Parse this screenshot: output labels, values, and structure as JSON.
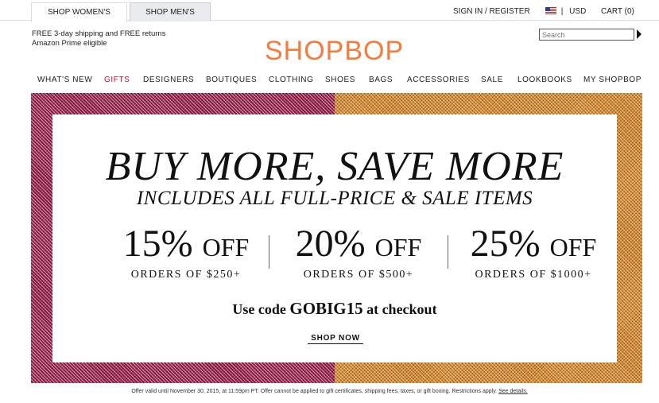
{
  "topbar": {
    "tab_women": "SHOP WOMEN'S",
    "tab_men": "SHOP MEN'S",
    "signin": "SIGN IN / REGISTER",
    "currency_sep": "|",
    "currency": "USD",
    "cart": "CART (0)"
  },
  "header": {
    "shipping_line1": "FREE 3-day shipping and FREE returns",
    "shipping_line2": "Amazon Prime eligible",
    "logo": "SHOPBOP",
    "search_placeholder": "Search"
  },
  "nav": {
    "items": [
      "WHAT'S NEW",
      "GIFTS",
      "DESIGNERS",
      "BOUTIQUES",
      "CLOTHING",
      "SHOES",
      "BAGS",
      "ACCESSORIES",
      "SALE",
      "LOOKBOOKS",
      "MY SHOPBOP"
    ],
    "highlight_color": "#c8102e"
  },
  "banner": {
    "headline": "BUY MORE, SAVE MORE",
    "subhead": "INCLUDES ALL FULL-PRICE & SALE ITEMS",
    "deals": [
      {
        "pct": "15%",
        "off": "OFF",
        "cond": "ORDERS OF $250+"
      },
      {
        "pct": "20%",
        "off": "OFF",
        "cond": "ORDERS OF $500+"
      },
      {
        "pct": "25%",
        "off": "OFF",
        "cond": "ORDERS OF $1000+"
      }
    ],
    "code_prefix": "Use code ",
    "code": "GOBIG15",
    "code_suffix": " at checkout",
    "cta": "SHOP NOW",
    "left_color": "#9b1f4a",
    "right_color": "#d98a2b"
  },
  "footer": {
    "fine_print": "Offer valid until November 30, 2015, at 11:59pm PT. Offer cannot be applied to gift certificates, shipping fees, taxes, or gift boxing. Restrictions apply. ",
    "details_link": "See details."
  },
  "brand": {
    "logo_color": "#f47c3c"
  }
}
